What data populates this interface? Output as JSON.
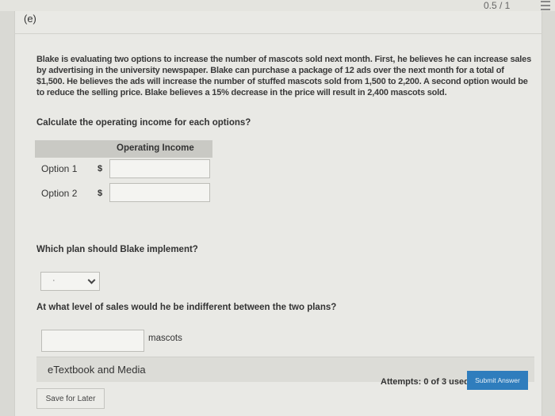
{
  "header": {
    "score": "0.5 / 1"
  },
  "part_label": "(e)",
  "question_text": "Blake is evaluating two options to increase the number of mascots sold next month. First, he believes he can increase sales by advertising in the university newspaper. Blake can purchase a package of 12 ads over the next month for a total of $1,500. He believes the ads will increase the number of stuffed mascots sold from 1,500 to 2,200. A second option would be to reduce the selling price. Blake believes a 15% decrease in the price will result in 2,400 mascots sold.",
  "prompt": "Calculate the operating income for each options?",
  "table": {
    "column_header": "Operating Income",
    "rows": [
      {
        "label": "Option 1",
        "currency": "$",
        "value": ""
      },
      {
        "label": "Option 2",
        "currency": "$",
        "value": ""
      }
    ]
  },
  "plan_question": "Which plan should Blake implement?",
  "plan_select": {
    "selected": "·"
  },
  "indifferent_question": "At what level of sales would he be indifferent between the two plans?",
  "mascots_input": {
    "value": "",
    "unit": "mascots"
  },
  "etextbook_label": "eTextbook and Media",
  "attempts_text": "Attempts: 0 of 3 used",
  "submit_label": "Submit Answer",
  "save_label": "Save for Later"
}
